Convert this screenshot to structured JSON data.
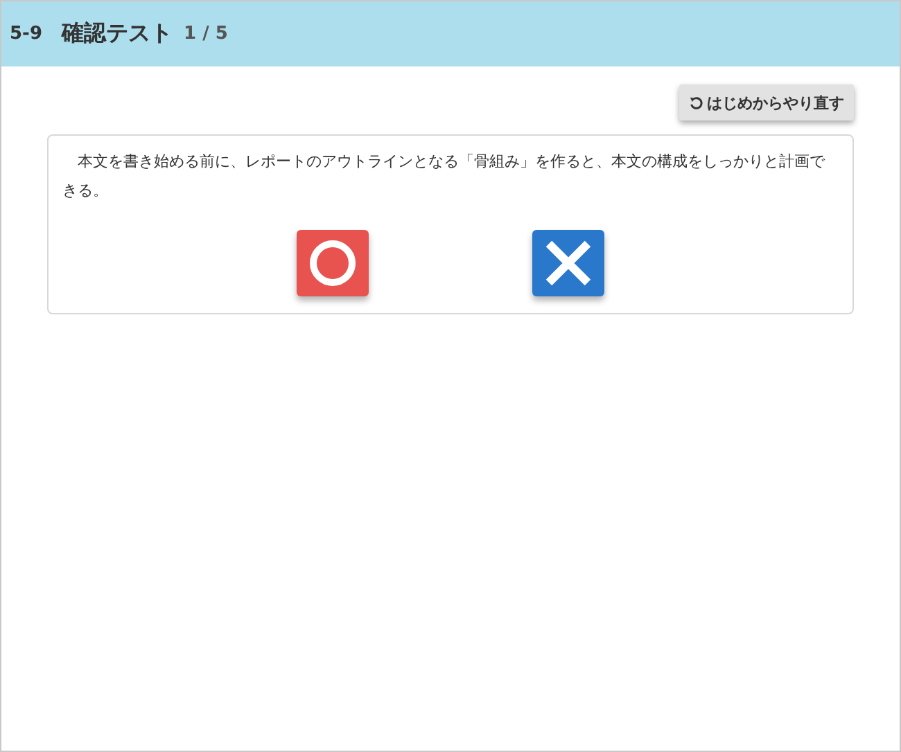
{
  "header": {
    "section": "5-9",
    "title": "確認テスト",
    "progress": "1 / 5"
  },
  "restart_button": {
    "label": "はじめからやり直す"
  },
  "question": {
    "text": "本文を書き始める前に、レポートのアウトラインとなる「骨組み」を作ると、本文の構成をしっかりと計画できる。"
  },
  "answers": [
    {
      "kind": "circle"
    },
    {
      "kind": "cross"
    }
  ]
}
